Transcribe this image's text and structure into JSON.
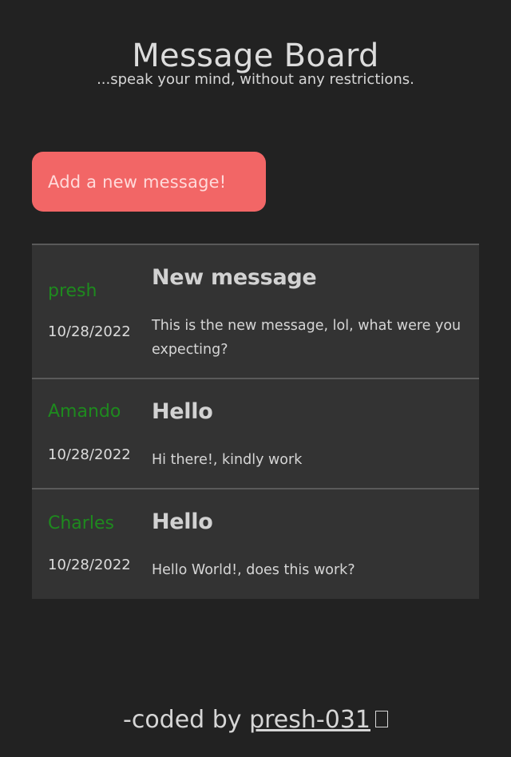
{
  "header": {
    "title": "Message Board",
    "subtitle": "...speak your mind, without any restrictions."
  },
  "add_button": {
    "label": "Add a new message!"
  },
  "messages": [
    {
      "author": "presh",
      "date": "10/28/2022",
      "title": "New message",
      "text": "This is the new message, lol, what were you expecting?"
    },
    {
      "author": "Amando",
      "date": "10/28/2022",
      "title": "Hello",
      "text": "Hi there!, kindly work"
    },
    {
      "author": "Charles",
      "date": "10/28/2022",
      "title": "Hello",
      "text": "Hello World!, does this work?"
    }
  ],
  "footer": {
    "prefix": "-coded by ",
    "link_text": "presh-031",
    "icon": "missing-glyph-icon"
  },
  "colors": {
    "background": "#222222",
    "card": "#333333",
    "button": "#f26666",
    "author": "#1e8a1e"
  }
}
